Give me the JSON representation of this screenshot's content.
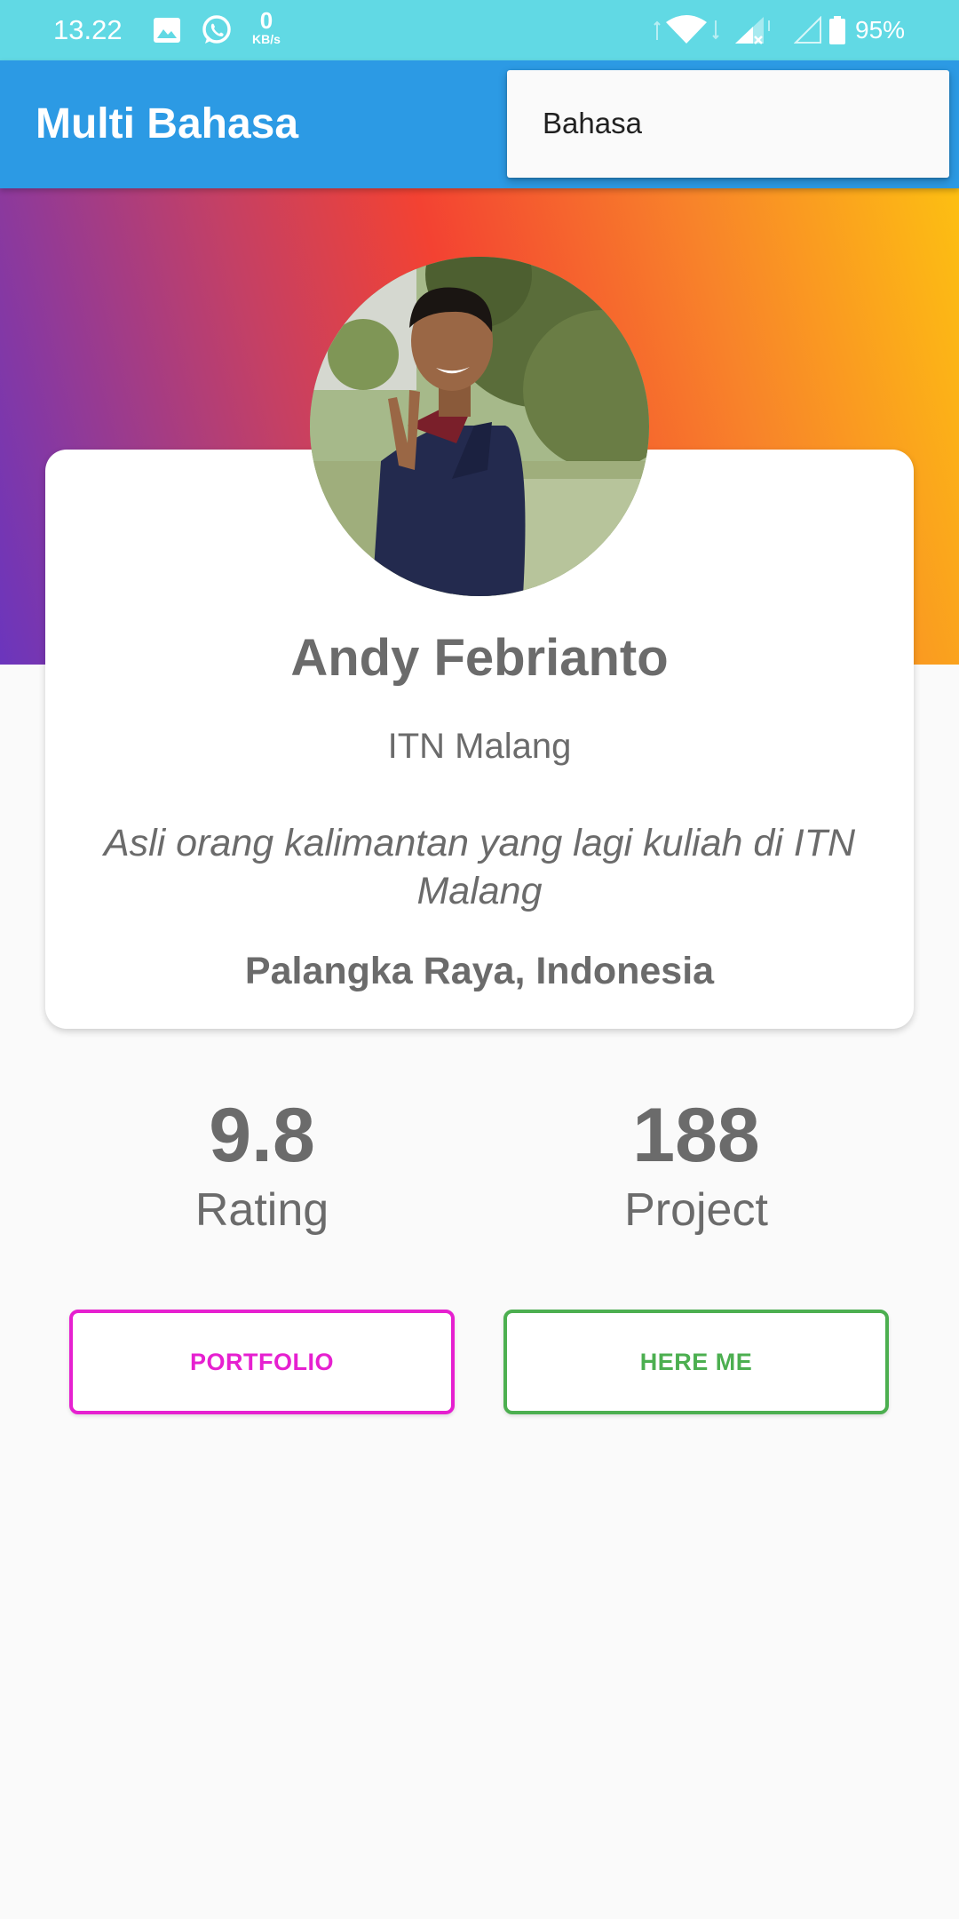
{
  "status_bar": {
    "time": "13.22",
    "network_speed_value": "0",
    "network_speed_unit": "KB/s",
    "battery_percent": "95%",
    "icons": [
      "gallery-icon",
      "whatsapp-icon",
      "wifi-icon",
      "signal-icon",
      "signal-empty-icon",
      "battery-icon"
    ]
  },
  "app_bar": {
    "title": "Multi Bahasa"
  },
  "overflow_menu": {
    "items": [
      {
        "label": "Bahasa"
      }
    ]
  },
  "profile": {
    "name": "Andy Febrianto",
    "campus": "ITN Malang",
    "bio": "Asli orang kalimantan yang lagi kuliah di ITN Malang",
    "location": "Palangka Raya, Indonesia"
  },
  "stats": [
    {
      "value": "9.8",
      "label": "Rating"
    },
    {
      "value": "188",
      "label": "Project"
    }
  ],
  "buttons": {
    "portfolio": "PORTFOLIO",
    "here_me": "HERE ME"
  },
  "colors": {
    "status_bar": "#61d9e4",
    "app_bar": "#2c9ae4",
    "portfolio_accent": "#e620d0",
    "here_me_accent": "#4caf50",
    "text_gray": "#6b6b6b"
  }
}
